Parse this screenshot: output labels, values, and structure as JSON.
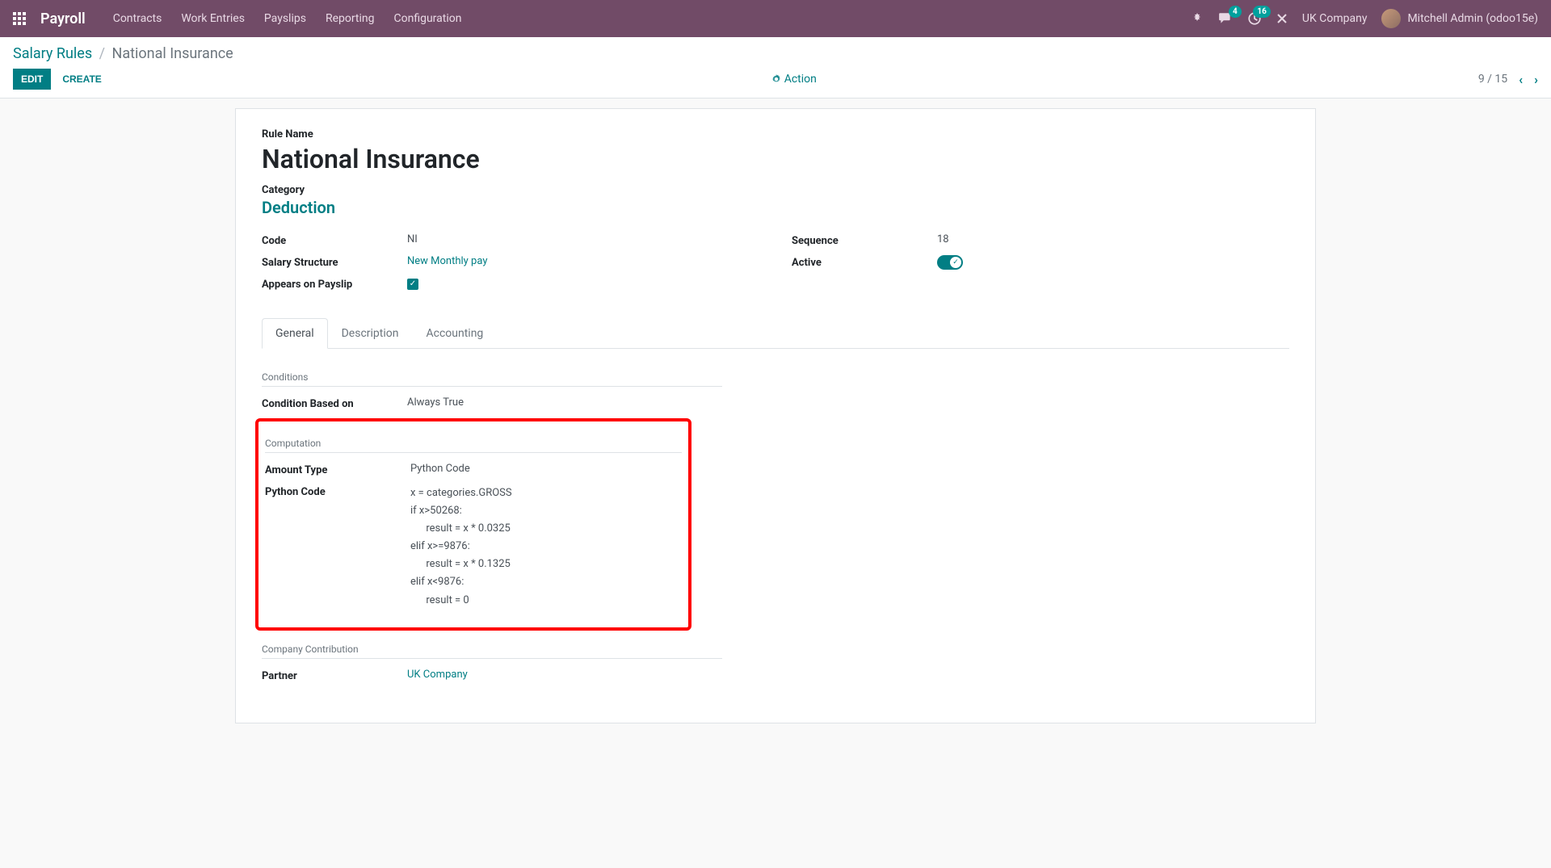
{
  "navbar": {
    "app_title": "Payroll",
    "menu": [
      "Contracts",
      "Work Entries",
      "Payslips",
      "Reporting",
      "Configuration"
    ],
    "messages_badge": "4",
    "activities_badge": "16",
    "company": "UK Company",
    "user": "Mitchell Admin (odoo15e)"
  },
  "breadcrumb": {
    "parent": "Salary Rules",
    "current": "National Insurance"
  },
  "controls": {
    "edit": "Edit",
    "create": "Create",
    "action": "Action",
    "pager": "9 / 15"
  },
  "form": {
    "rule_name_label": "Rule Name",
    "rule_name": "National Insurance",
    "category_label": "Category",
    "category": "Deduction",
    "fields_left": {
      "code_label": "Code",
      "code": "NI",
      "salary_structure_label": "Salary Structure",
      "salary_structure": "New Monthly pay",
      "appears_label": "Appears on Payslip"
    },
    "fields_right": {
      "sequence_label": "Sequence",
      "sequence": "18",
      "active_label": "Active"
    },
    "tabs": [
      "General",
      "Description",
      "Accounting"
    ],
    "sections": {
      "conditions_title": "Conditions",
      "condition_based_label": "Condition Based on",
      "condition_based": "Always True",
      "computation_title": "Computation",
      "amount_type_label": "Amount Type",
      "amount_type": "Python Code",
      "python_code_label": "Python Code",
      "python_code": "x = categories.GROSS\nif x>50268:\n      result = x * 0.0325\nelif x>=9876:\n      result = x * 0.1325\nelif x<9876:\n      result = 0",
      "company_contribution_title": "Company Contribution",
      "partner_label": "Partner",
      "partner": "UK Company"
    }
  }
}
